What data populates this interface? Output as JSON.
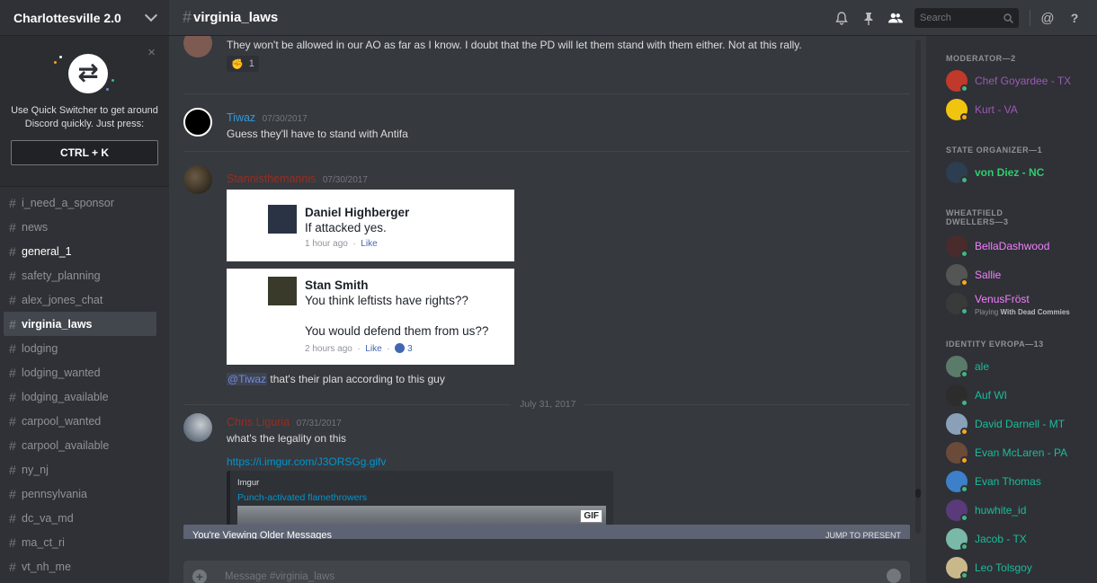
{
  "server": {
    "name": "Charlottesville 2.0"
  },
  "quick_switcher": {
    "close": "×",
    "text_line1": "Use Quick Switcher to get around",
    "text_line2": "Discord quickly. Just press:",
    "key": "CTRL + K"
  },
  "channels": [
    "i_need_a_sponsor",
    "news",
    "general_1",
    "safety_planning",
    "alex_jones_chat",
    "virginia_laws",
    "lodging",
    "lodging_wanted",
    "lodging_available",
    "carpool_wanted",
    "carpool_available",
    "ny_nj",
    "pennsylvania",
    "dc_va_md",
    "ma_ct_ri",
    "vt_nh_me"
  ],
  "channel_states": {
    "unread": "general_1",
    "active": "virginia_laws"
  },
  "header": {
    "hash": "#",
    "channel": "virginia_laws",
    "search_placeholder": "Search",
    "icons": [
      "bell-icon",
      "pin-icon",
      "members-icon",
      "mentions-icon",
      "help-icon"
    ]
  },
  "messages": [
    {
      "author": "",
      "timestamp": "",
      "text": "They won't be allowed in our AO as far as I know. I doubt that the PD will let them stand with them either. Not at this rally.",
      "reaction_count": "1"
    },
    {
      "author": "Tiwaz",
      "author_color": "#3498db",
      "timestamp": "07/30/2017",
      "text": "Guess they'll have to stand with Antifa"
    },
    {
      "author": "Stannisthemannis",
      "author_color": "#992d22",
      "timestamp": "07/30/2017",
      "fb_cards": [
        {
          "name": "Daniel Highberger",
          "lines": [
            "If attacked yes."
          ],
          "time": "1 hour ago",
          "like": "Like",
          "likes": ""
        },
        {
          "name": "Stan Smith",
          "lines": [
            "You think leftists have rights??",
            "You would defend them from us??"
          ],
          "time": "2 hours ago",
          "like": "Like",
          "likes": "3"
        }
      ],
      "mention": "@Tiwaz",
      "text": " that's their plan according to this guy"
    },
    {
      "author": "Chris Liguria",
      "author_color": "#992d22",
      "timestamp": "07/31/2017",
      "text": "what's the legality on this",
      "link": "https://i.imgur.com/J3ORSGg.gifv",
      "embed": {
        "provider": "Imgur",
        "title": "Punch-activated flamethrowers",
        "badge": "GIF"
      }
    }
  ],
  "date_divider": "July 31, 2017",
  "older_bar": {
    "text": "You're Viewing Older Messages",
    "jump": "JUMP TO PRESENT"
  },
  "composer": {
    "placeholder": "Message #virginia_laws"
  },
  "member_groups": [
    {
      "role": "MODERATOR—2",
      "members": [
        {
          "name": "Chef Goyardee - TX",
          "color": "#9b59b6",
          "status": "online"
        },
        {
          "name": "Kurt - VA",
          "color": "#9b59b6",
          "status": "idle"
        }
      ]
    },
    {
      "role": "STATE ORGANIZER—1",
      "members": [
        {
          "name": "von Diez - NC",
          "color": "#2ecc71",
          "status": "online",
          "bold": true
        }
      ]
    },
    {
      "role": "WHEATFIELD DWELLERS—3",
      "members": [
        {
          "name": "BellaDashwood",
          "color": "#f47fff",
          "status": "online"
        },
        {
          "name": "Sallie",
          "color": "#f47fff",
          "status": "idle"
        },
        {
          "name": "VenusFröst",
          "color": "#f47fff",
          "status": "online",
          "activity": "Playing",
          "game": "With Dead Commies"
        }
      ]
    },
    {
      "role": "IDENTITY EVROPA—13",
      "members": [
        {
          "name": "ale",
          "color": "#1abc9c",
          "status": "online"
        },
        {
          "name": "Auf WI",
          "color": "#1abc9c",
          "status": "online"
        },
        {
          "name": "David Darnell - MT",
          "color": "#1abc9c",
          "status": "idle"
        },
        {
          "name": "Evan McLaren - PA",
          "color": "#1abc9c",
          "status": "idle"
        },
        {
          "name": "Evan Thomas",
          "color": "#1abc9c",
          "status": "online"
        },
        {
          "name": "huwhite_id",
          "color": "#1abc9c",
          "status": "online"
        },
        {
          "name": "Jacob - TX",
          "color": "#1abc9c",
          "status": "online"
        },
        {
          "name": "Leo Tolsgoy",
          "color": "#1abc9c",
          "status": "online"
        }
      ]
    }
  ],
  "colors": {
    "background": "#36393e",
    "sidebar": "#2f3136",
    "online": "#43b581",
    "idle": "#faa61a",
    "link": "#0096cf"
  }
}
